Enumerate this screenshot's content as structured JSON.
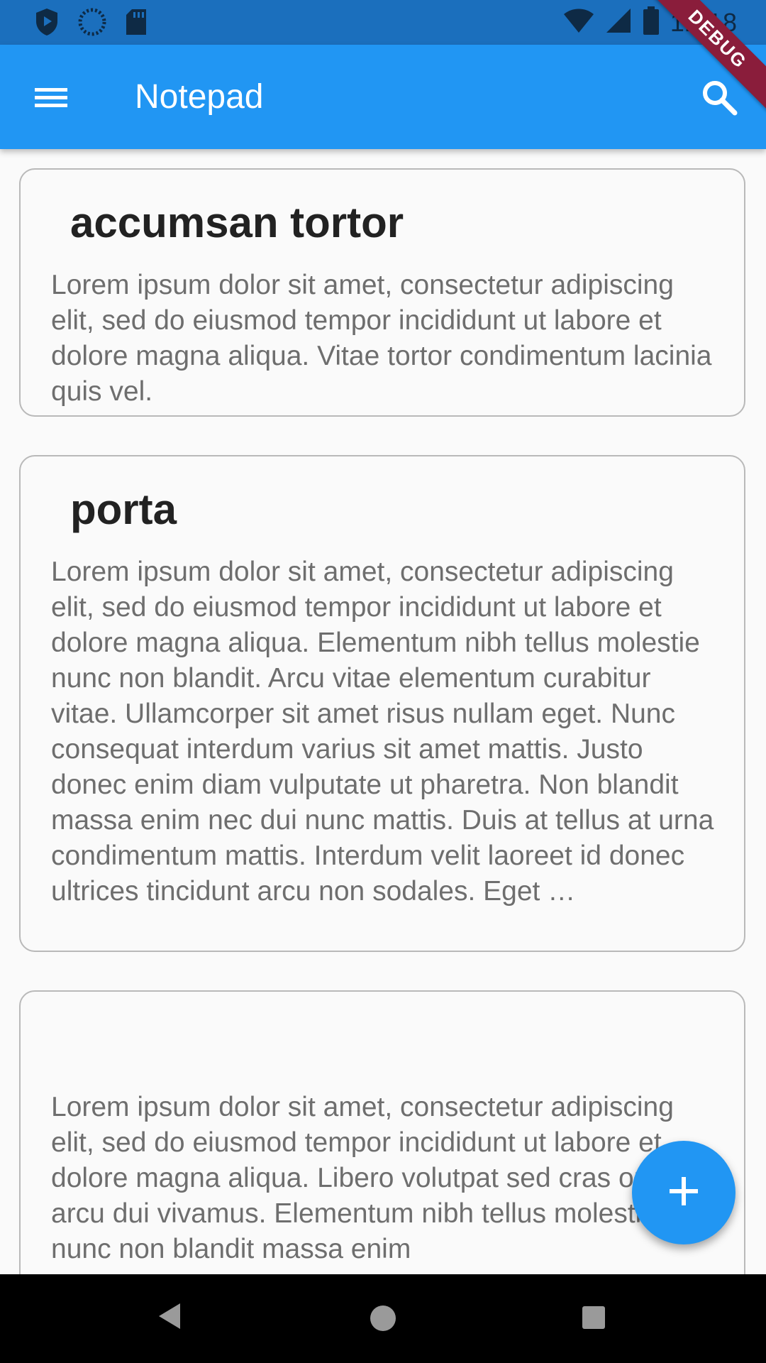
{
  "status_bar": {
    "time": "12:18",
    "icons": [
      "shield-icon",
      "sync-icon",
      "sd-card-icon",
      "wifi-icon",
      "signal-icon",
      "battery-icon"
    ]
  },
  "app_bar": {
    "title": "Notepad",
    "menu_icon": "menu-icon",
    "search_icon": "search-icon",
    "color": "#2196f3"
  },
  "debug_banner": "DEBUG",
  "notes": [
    {
      "title": "accumsan tortor",
      "body": "Lorem ipsum dolor sit amet, consectetur adipiscing elit, sed do eiusmod tempor incididunt ut labore et dolore magna aliqua. Vitae tortor condimentum lacinia quis vel."
    },
    {
      "title": "porta",
      "body": "Lorem ipsum dolor sit amet, consectetur adipiscing elit, sed do eiusmod tempor incididunt ut labore et dolore magna aliqua. Elementum nibh tellus molestie nunc non blandit. Arcu vitae elementum curabitur vitae. Ullamcorper sit amet risus nullam eget. Nunc consequat interdum varius sit amet mattis. Justo donec enim diam vulputate ut pharetra. Non blandit massa enim nec dui nunc mattis. Duis at tellus at urna condimentum mattis. Interdum velit laoreet id donec ultrices tincidunt arcu non sodales. Eget …"
    },
    {
      "title": "",
      "body": "Lorem ipsum dolor sit amet, consectetur adipiscing elit, sed do eiusmod tempor incididunt ut labore et dolore magna aliqua. Libero volutpat sed cras ornare arcu dui vivamus. Elementum nibh tellus molestie nunc non blandit massa enim"
    }
  ],
  "fab": {
    "icon": "add-icon"
  },
  "nav_bar": {
    "icons": [
      "back-icon",
      "home-icon",
      "recents-icon"
    ]
  }
}
